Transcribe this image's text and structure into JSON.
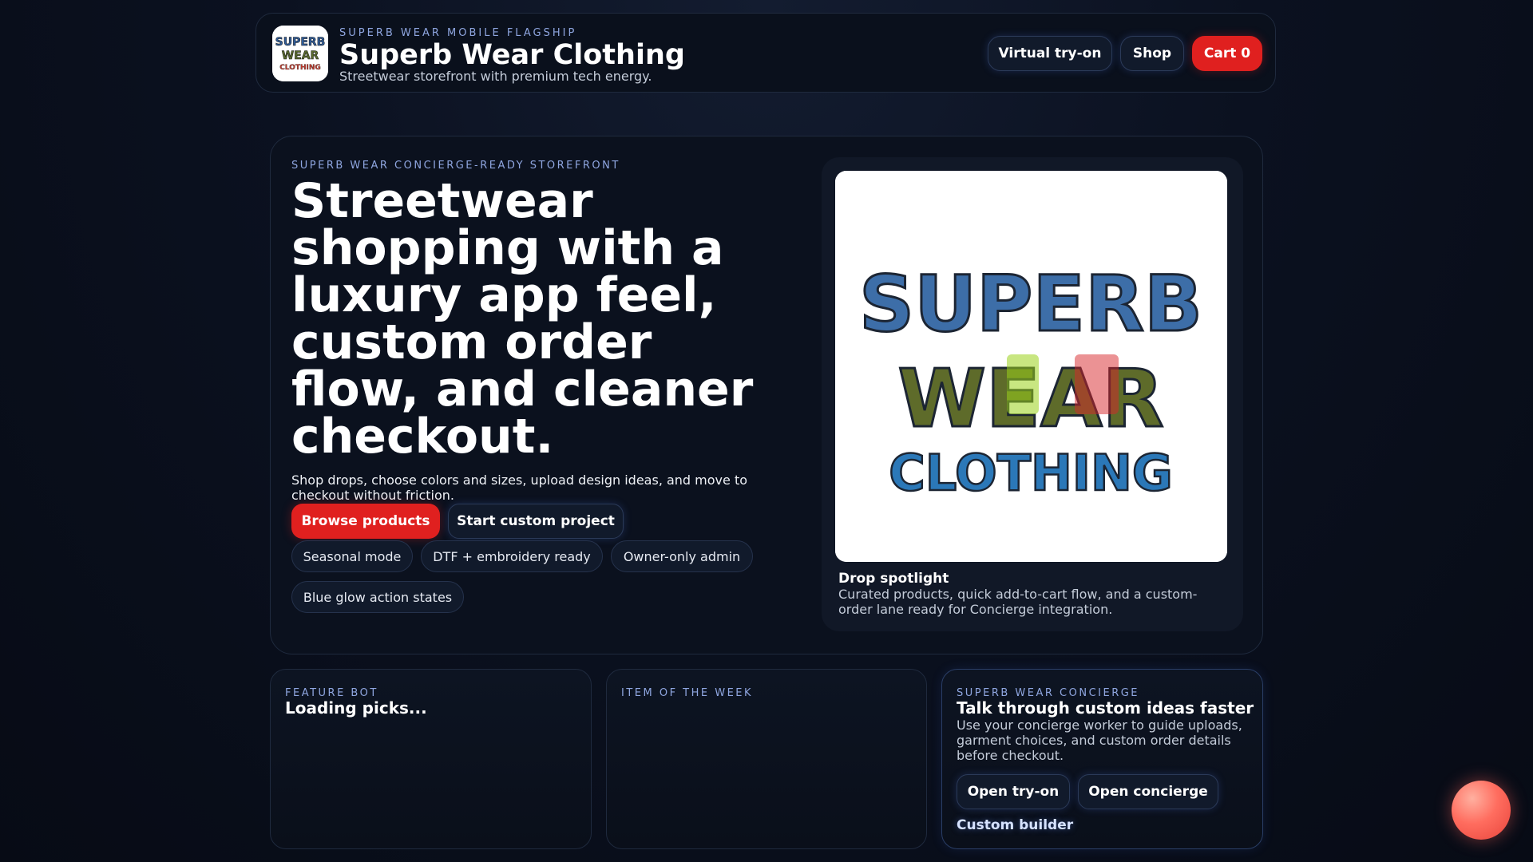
{
  "header": {
    "eyebrow": "SUPERB WEAR MOBILE FLAGSHIP",
    "title": "Superb Wear Clothing",
    "tagline": "Streetwear storefront with premium tech energy.",
    "logo_text": [
      "SUPERB",
      "WEAR",
      "CLOTHING"
    ],
    "nav": {
      "tryon_label": "Virtual try-on",
      "shop_label": "Shop",
      "cart_label": "Cart 0"
    }
  },
  "hero": {
    "eyebrow": "SUPERB WEAR CONCIERGE-READY STOREFRONT",
    "title": "Streetwear shopping with a luxury app feel, custom order flow, and cleaner checkout.",
    "subtitle": "Shop drops, choose colors and sizes, upload design ideas, and move to checkout without friction.",
    "primary_cta": "Browse products",
    "secondary_cta": "Start custom project",
    "pills": [
      "Seasonal mode",
      "DTF + embroidery ready",
      "Owner-only admin",
      "Blue glow action states"
    ]
  },
  "spotlight": {
    "image_text": [
      "SUPERB",
      "WEAR",
      "CLOTHING"
    ],
    "title": "Drop spotlight",
    "description": "Curated products, quick add-to-cart flow, and a custom-order lane ready for Concierge integration."
  },
  "cards": {
    "feature_bot": {
      "eyebrow": "FEATURE BOT",
      "title": "Loading picks..."
    },
    "item_week": {
      "eyebrow": "ITEM OF THE WEEK"
    },
    "concierge": {
      "eyebrow": "SUPERB WEAR CONCIERGE",
      "title": "Talk through custom ideas faster",
      "description": "Use your concierge worker to guide uploads, garment choices, and custom order details before checkout.",
      "tryon_label": "Open try-on",
      "concierge_label": "Open concierge",
      "builder_link": "Custom builder"
    }
  },
  "colors": {
    "accent_red": "#e0201f",
    "eyebrow_blue": "#8fa6e0",
    "background": "#0b1120"
  },
  "icons": {
    "fab": "chat-orb-icon"
  }
}
